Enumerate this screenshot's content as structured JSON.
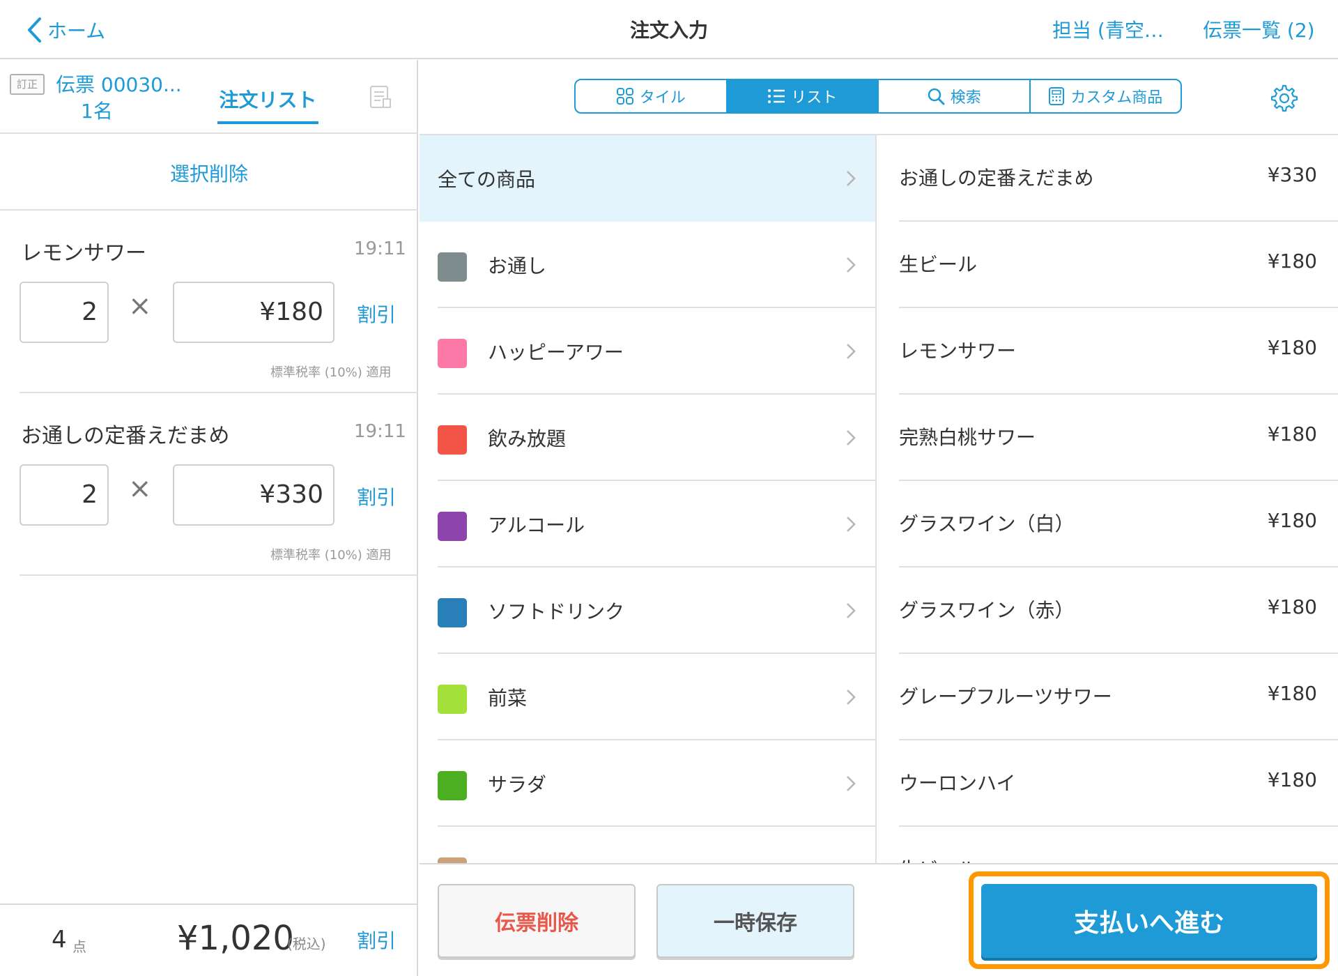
{
  "header": {
    "back_label": "ホーム",
    "title": "注文入力",
    "staff_label": "担当 (青空…",
    "slips_label": "伝票一覧 (2)"
  },
  "slip": {
    "badge": "訂正",
    "number": "伝票 00030...",
    "people": "1名",
    "tab_label": "注文リスト",
    "select_delete_label": "選択削除"
  },
  "order_items": [
    {
      "name": "レモンサワー",
      "time": "19:11",
      "qty": "2",
      "price": "¥180",
      "discount_label": "割引",
      "tax_note": "標準税率 (10%) 適用"
    },
    {
      "name": "お通しの定番えだまめ",
      "time": "19:11",
      "qty": "2",
      "price": "¥330",
      "discount_label": "割引",
      "tax_note": "標準税率 (10%) 適用"
    }
  ],
  "multiply_sign": "×",
  "footer": {
    "count": "4",
    "count_unit": "点",
    "total": "¥1,020",
    "tax_label": "(税込)",
    "discount_label": "割引"
  },
  "view_tabs": [
    {
      "label": "タイル",
      "icon": "tile-icon",
      "active": false
    },
    {
      "label": "リスト",
      "icon": "list-icon",
      "active": true
    },
    {
      "label": "検索",
      "icon": "search-icon",
      "active": false
    },
    {
      "label": "カスタム商品",
      "icon": "calculator-icon",
      "active": false
    }
  ],
  "categories": [
    {
      "label": "全ての商品",
      "color": null,
      "active": true
    },
    {
      "label": "お通し",
      "color": "#7f8c8d"
    },
    {
      "label": "ハッピーアワー",
      "color": "#fd79a8"
    },
    {
      "label": "飲み放題",
      "color": "#f25545"
    },
    {
      "label": "アルコール",
      "color": "#8e44ad"
    },
    {
      "label": "ソフトドリンク",
      "color": "#2980b9"
    },
    {
      "label": "前菜",
      "color": "#a4e03a"
    },
    {
      "label": "サラダ",
      "color": "#4caf22"
    },
    {
      "label": "",
      "color": "#c9a27a"
    }
  ],
  "products": [
    {
      "name": "お通しの定番えだまめ",
      "price": "¥330"
    },
    {
      "name": "生ビール",
      "price": "¥180"
    },
    {
      "name": "レモンサワー",
      "price": "¥180"
    },
    {
      "name": "完熟白桃サワー",
      "price": "¥180"
    },
    {
      "name": "グラスワイン（白）",
      "price": "¥180"
    },
    {
      "name": "グラスワイン（赤）",
      "price": "¥180"
    },
    {
      "name": "グレープフルーツサワー",
      "price": "¥180"
    },
    {
      "name": "ウーロンハイ",
      "price": "¥180"
    },
    {
      "name": "生ビール",
      "price": ""
    }
  ],
  "actions": {
    "delete_slip": "伝票削除",
    "temp_save": "一時保存",
    "proceed_payment": "支払いへ進む"
  },
  "colors": {
    "accent": "#1e9bd7",
    "highlight": "#ff9800",
    "danger": "#e8584a",
    "active_bg": "#e3f4fd"
  }
}
